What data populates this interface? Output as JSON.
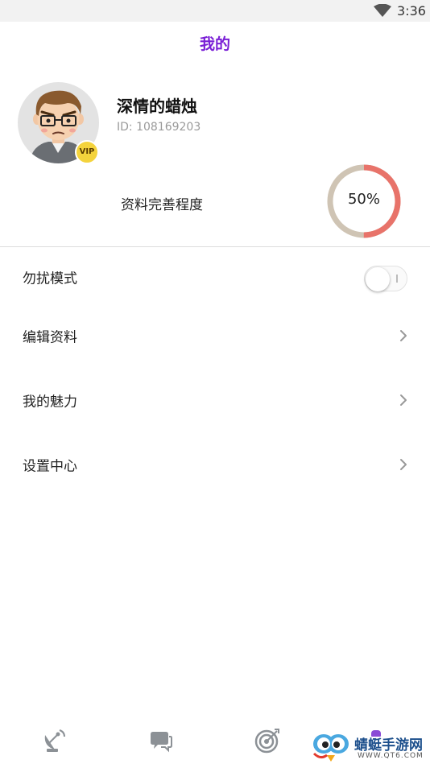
{
  "status_bar": {
    "time": "3:36",
    "wifi_icon": "wifi-icon"
  },
  "header": {
    "title": "我的",
    "title_color": "#7a1fd6"
  },
  "profile": {
    "username": "深情的蜡烛",
    "user_id": "ID: 108169203",
    "avatar_icon": "avatar-cartoon-man",
    "vip_badge": "VIP"
  },
  "completion": {
    "label": "资料完善程度",
    "percent": 50,
    "percent_text": "50%",
    "filled_color": "#e8736a",
    "remaining_color": "#cfc4b4"
  },
  "menu": {
    "do_not_disturb": {
      "label": "勿扰模式",
      "enabled": false
    },
    "edit_profile": {
      "label": "编辑资料"
    },
    "my_charm": {
      "label": "我的魅力"
    },
    "settings": {
      "label": "设置中心"
    }
  },
  "tabbar": {
    "tabs": [
      {
        "icon": "satellite-dish-icon"
      },
      {
        "icon": "chat-bubbles-icon"
      },
      {
        "icon": "target-icon"
      },
      {
        "icon": "profile-icon",
        "active": true
      }
    ]
  },
  "watermark": {
    "name": "蜻蜓手游网",
    "url": "WWW.QT6.COM"
  }
}
